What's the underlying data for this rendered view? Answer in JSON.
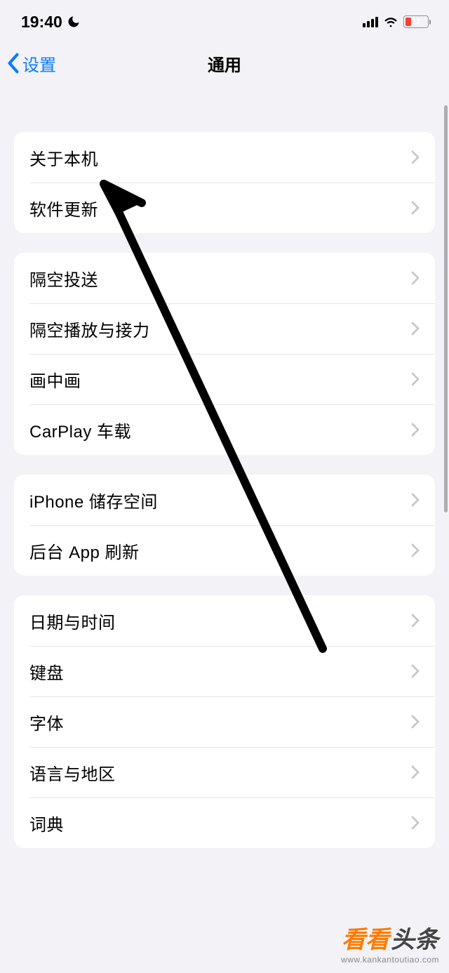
{
  "status": {
    "time": "19:40",
    "battery_percent": "12"
  },
  "nav": {
    "back_label": "设置",
    "title": "通用"
  },
  "groups": [
    {
      "items": [
        {
          "label": "关于本机"
        },
        {
          "label": "软件更新"
        }
      ]
    },
    {
      "items": [
        {
          "label": "隔空投送"
        },
        {
          "label": "隔空播放与接力"
        },
        {
          "label": "画中画"
        },
        {
          "label": "CarPlay 车载"
        }
      ]
    },
    {
      "items": [
        {
          "label": "iPhone 储存空间"
        },
        {
          "label": "后台 App 刷新"
        }
      ]
    },
    {
      "items": [
        {
          "label": "日期与时间"
        },
        {
          "label": "键盘"
        },
        {
          "label": "字体"
        },
        {
          "label": "语言与地区"
        },
        {
          "label": "词典"
        }
      ]
    }
  ],
  "watermark": {
    "brand_a": "看看",
    "brand_b": "头条",
    "url": "www.kankantoutiao.com"
  }
}
